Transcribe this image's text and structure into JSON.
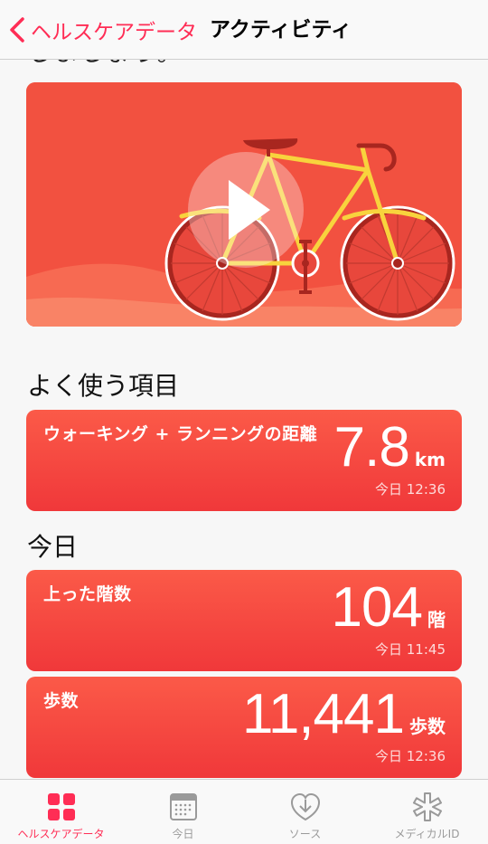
{
  "colors": {
    "accent": "#ff2d55",
    "card_red": "#f44a3d",
    "tab_inactive": "#9a9a9a"
  },
  "nav": {
    "back_label": "ヘルスケアデータ",
    "title": "アクティビティ"
  },
  "clipped_heading": "しましょう。",
  "video": {
    "play_icon": "play-icon",
    "illustration": "bicycle"
  },
  "sections": {
    "favorites": "よく使う項目",
    "today": "今日"
  },
  "cards": {
    "distance": {
      "title": "ウォーキング + ランニングの距離",
      "value": "7.8",
      "unit": "km",
      "time": "今日 12:36"
    },
    "flights": {
      "title": "上った階数",
      "value": "104",
      "unit": "階",
      "time": "今日 11:45"
    },
    "steps": {
      "title": "歩数",
      "value": "11,441",
      "unit": "歩数",
      "time": "今日 12:36"
    }
  },
  "tabs": [
    {
      "label": "ヘルスケアデータ",
      "icon": "health-data-icon",
      "active": true
    },
    {
      "label": "今日",
      "icon": "calendar-icon",
      "active": false
    },
    {
      "label": "ソース",
      "icon": "sources-icon",
      "active": false
    },
    {
      "label": "メディカルID",
      "icon": "medical-id-icon",
      "active": false
    }
  ]
}
